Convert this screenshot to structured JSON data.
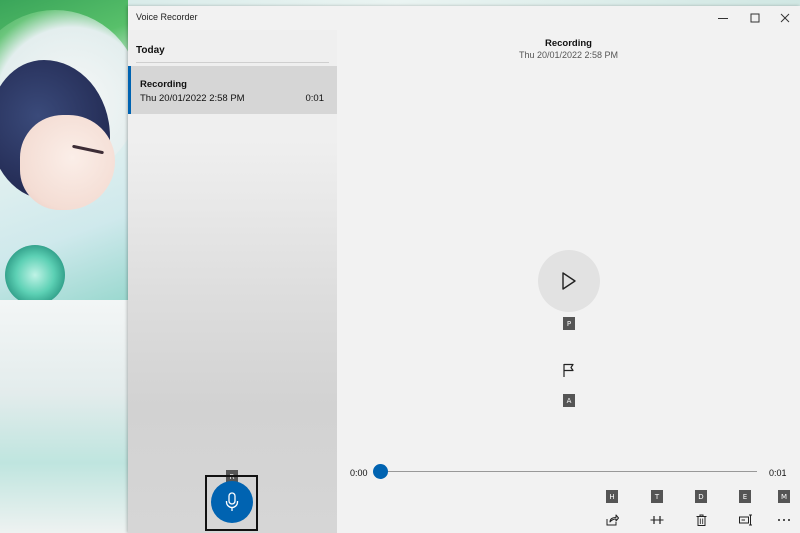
{
  "window": {
    "title": "Voice Recorder",
    "controls": {
      "minimize": "—",
      "maximize": "☐",
      "close": "✕"
    }
  },
  "list": {
    "group_label": "Today",
    "items": [
      {
        "name": "Recording",
        "date": "Thu 20/01/2022 2:58 PM",
        "duration": "0:01",
        "selected": true
      }
    ]
  },
  "detail": {
    "name": "Recording",
    "date": "Thu 20/01/2022 2:58 PM"
  },
  "playback": {
    "current_time": "0:00",
    "total_time": "0:01",
    "progress": 0
  },
  "access_keys": {
    "record": "R",
    "play": "P",
    "add_marker": "A",
    "share": "H",
    "trim": "T",
    "delete": "D",
    "rename": "E",
    "more": "M"
  },
  "icons": {
    "record": "microphone-icon",
    "play": "play-icon",
    "marker": "flag-icon",
    "share": "share-icon",
    "trim": "trim-icon",
    "delete": "trash-icon",
    "rename": "rename-icon",
    "more": "more-icon"
  },
  "colors": {
    "accent": "#0063b1",
    "selected_item": "#d6d6d6"
  }
}
